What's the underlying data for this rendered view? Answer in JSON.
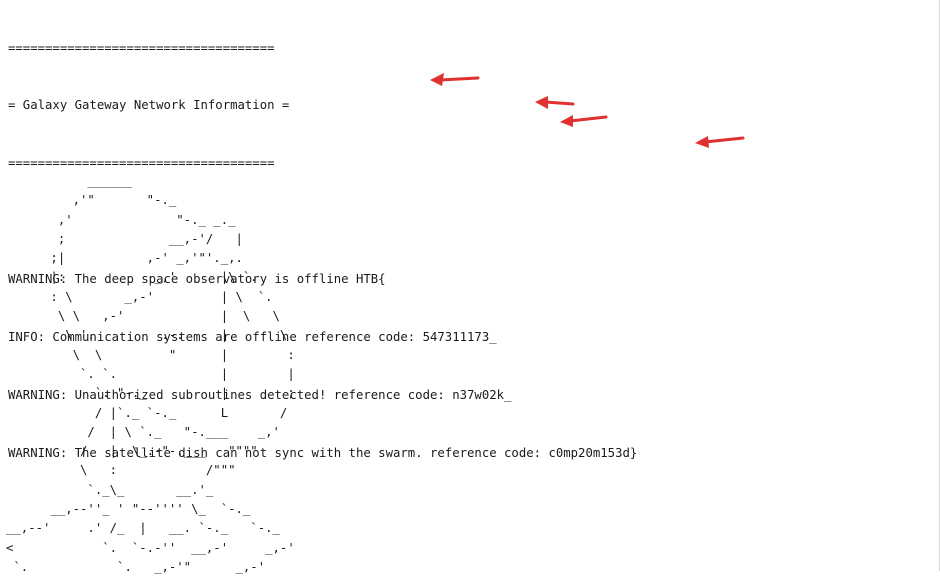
{
  "banner": {
    "border_top": "====================================",
    "title": "= Galaxy Gateway Network Information =",
    "border_bottom": "===================================="
  },
  "messages": [
    "WARNING: The deep space observatory is offline HTB{",
    "INFO: Communication systems are offline reference code: 547311173_",
    "WARNING: Unauthorized subroutines detected! reference code: n37w02k_",
    "WARNING: The satellite dish can not sync with the swarm. reference code: c0mp20m153d}"
  ],
  "ascii_art": "           ______\n         ,'\"       \"-._\n       ,'              \"-._ _._\n       ;              __,-'/   |\n      ;|           ,-' _,'\"'._,.\n      |:            _,'      |\\ `.\n      : \\       _,-'         | \\  `.\n       \\ \\   ,-'             |  \\   \\\n        \\ '.         .-.     |       \\\n         \\  \\         \"      |        :\n          `. `.              |        |\n            `. \"-._          |        ;\n            / |`._ `-._      L       /\n           /  | \\ `._   \"-.___    _,'\n          /   |  \\_.-\"-.___   \"\"\"\"\n          \\   :            /\"\"\"\n           `._\\_       __.'_\n      __,--''_ ' \"--'''' \\_  `-._\n__,--'     .' /_  |   __. `-._   `-._\n<            `.  `-.-''  __,-'     _,-'\n `.            `.   _,-'\"      _,-'",
  "accent_color": "#e03030"
}
